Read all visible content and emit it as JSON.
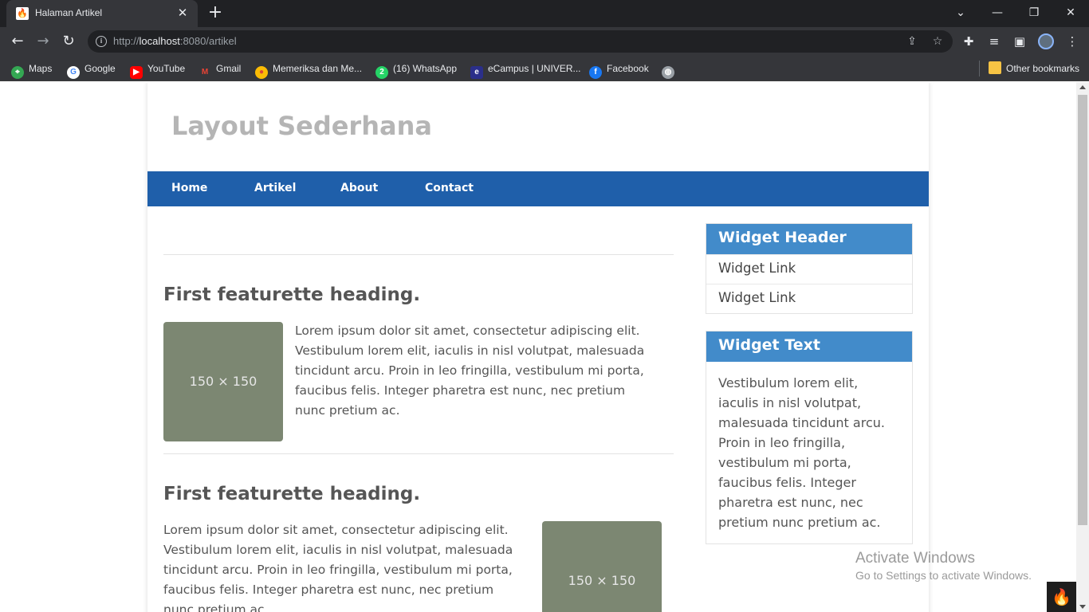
{
  "browser": {
    "tab_title": "Halaman Artikel",
    "url_scheme": "http://",
    "url_host": "localhost",
    "url_rest": ":8080/artikel",
    "bookmarks": [
      {
        "label": "Maps",
        "icon": "maps-icon",
        "color": "#34a853"
      },
      {
        "label": "Google",
        "icon": "google-icon",
        "color": "#ffffff"
      },
      {
        "label": "YouTube",
        "icon": "youtube-icon",
        "color": "#ff0000"
      },
      {
        "label": "Gmail",
        "icon": "gmail-icon",
        "color": "#ea4335"
      },
      {
        "label": "Memeriksa dan Me...",
        "icon": "chrome-icon",
        "color": "#fbbc05"
      },
      {
        "label": "(16) WhatsApp",
        "icon": "whatsapp-icon",
        "color": "#25d366"
      },
      {
        "label": "eCampus | UNIVER...",
        "icon": "ecampus-icon",
        "color": "#2b2f8a"
      },
      {
        "label": "Facebook",
        "icon": "facebook-icon",
        "color": "#1877f2"
      }
    ],
    "other_bookmarks": "Other bookmarks"
  },
  "site": {
    "title": "Layout Sederhana",
    "nav": [
      "Home",
      "Artikel",
      "About",
      "Contact"
    ]
  },
  "features": [
    {
      "heading": "First featurette heading.",
      "image_label": "150 × 150",
      "text": "Lorem ipsum dolor sit amet, consectetur adipiscing elit. Vestibulum lorem elit, iaculis in nisl volutpat, malesuada tincidunt arcu. Proin in leo fringilla, vestibulum mi porta, faucibus felis. Integer pharetra est nunc, nec pretium nunc pretium ac."
    },
    {
      "heading": "First featurette heading.",
      "image_label": "150 × 150",
      "text": "Lorem ipsum dolor sit amet, consectetur adipiscing elit. Vestibulum lorem elit, iaculis in nisl volutpat, malesuada tincidunt arcu. Proin in leo fringilla, vestibulum mi porta, faucibus felis. Integer pharetra est nunc, nec pretium nunc pretium ac."
    }
  ],
  "sidebar": {
    "widget1_header": "Widget Header",
    "widget1_links": [
      "Widget Link",
      "Widget Link"
    ],
    "widget2_header": "Widget Text",
    "widget2_text": "Vestibulum lorem elit, iaculis in nisl volutpat, malesuada tincidunt arcu. Proin in leo fringilla, vestibulum mi porta, faucibus felis. Integer pharetra est nunc, nec pretium nunc pretium ac."
  },
  "os": {
    "activate_title": "Activate Windows",
    "activate_sub": "Go to Settings to activate Windows."
  }
}
